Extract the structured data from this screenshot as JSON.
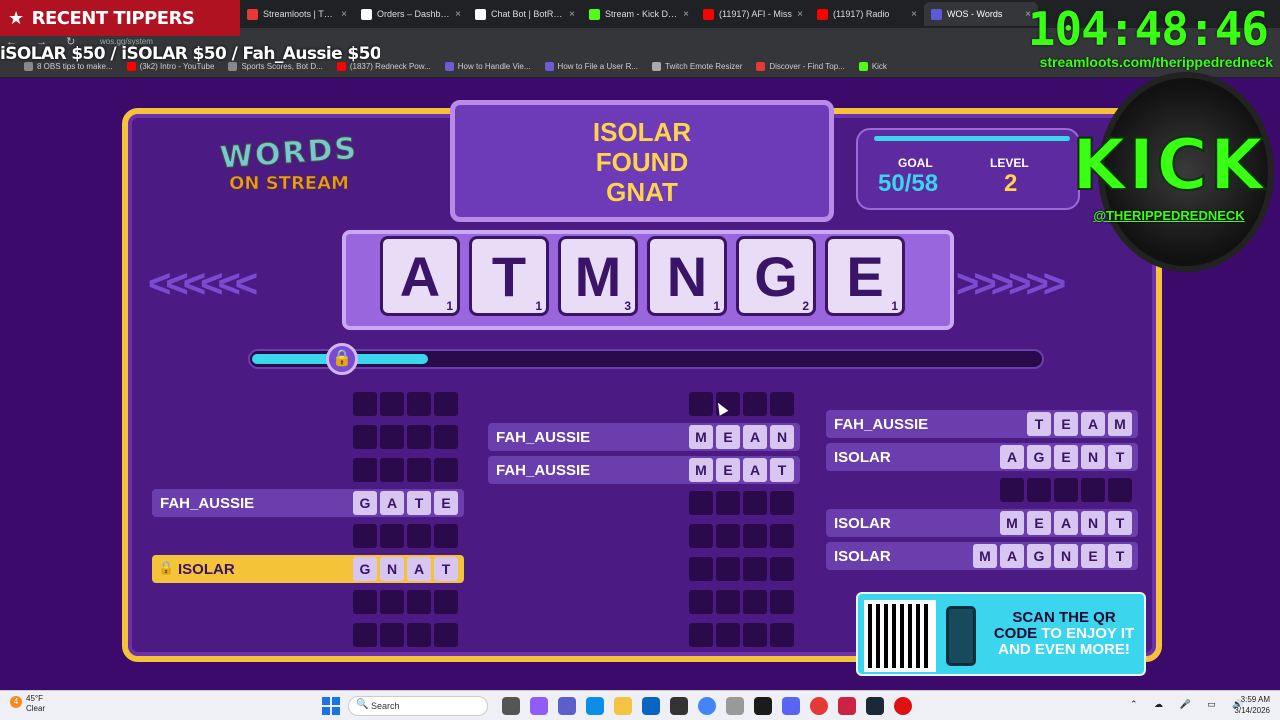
{
  "browser": {
    "tabs": [
      {
        "label": "Streamloots | Ther",
        "color": "#e53935"
      },
      {
        "label": "Orders – Dashboard",
        "color": "#ffffff"
      },
      {
        "label": "Chat Bot | BotRix -",
        "color": "#ffffff"
      },
      {
        "label": "Stream - Kick Dash",
        "color": "#53fc18"
      },
      {
        "label": "(11917) AFI - Miss",
        "color": "#ff0000"
      },
      {
        "label": "(11917) Radio",
        "color": "#ff0000"
      },
      {
        "label": "WOS - Words",
        "color": "#5b5bd6",
        "active": true
      }
    ],
    "url": "wos.gg/system",
    "bookmarks": [
      {
        "label": "8 OBS tips to make...",
        "color": "#888"
      },
      {
        "label": "(3k2) Intro - YouTube",
        "color": "#ff0000"
      },
      {
        "label": "Sports Scores, Bot D...",
        "color": "#888"
      },
      {
        "label": "(1837) Redneck Pow...",
        "color": "#ff0000"
      },
      {
        "label": "How to Handle Vie...",
        "color": "#6b5bd6"
      },
      {
        "label": "How to File a User R...",
        "color": "#6b5bd6"
      },
      {
        "label": "Twitch Emote Resizer",
        "color": "#aaa"
      },
      {
        "label": "Discover - Find Top...",
        "color": "#e53935"
      },
      {
        "label": "Kick",
        "color": "#53fc18"
      }
    ]
  },
  "overlay": {
    "recent_tippers": "RECENT TIPPERS",
    "ticker": "iSOLAR $50 / iSOLAR $50 / Fah_Aussie $50 /",
    "timer": "104:48:46",
    "streamloots_url": "streamloots.com/therippedredneck",
    "kick_word": "KICK",
    "kick_handle": "@THERIPPEDREDNECK"
  },
  "game": {
    "logo_top": "WORDS",
    "logo_bottom": "ON STREAM",
    "message": [
      "ISOLAR",
      "FOUND",
      "GNAT"
    ],
    "goal_label": "GOAL",
    "goal_value": "50/58",
    "level_label": "LEVEL",
    "level_value": "2",
    "letters": [
      {
        "char": "A",
        "pts": "1"
      },
      {
        "char": "T",
        "pts": "1"
      },
      {
        "char": "M",
        "pts": "3"
      },
      {
        "char": "N",
        "pts": "1"
      },
      {
        "char": "G",
        "pts": "2"
      },
      {
        "char": "E",
        "pts": "1"
      }
    ],
    "columns": [
      [
        {
          "name": "",
          "letters": [
            "",
            "",
            "",
            ""
          ]
        },
        {
          "name": "",
          "letters": [
            "",
            "",
            "",
            ""
          ]
        },
        {
          "name": "",
          "letters": [
            "",
            "",
            "",
            ""
          ]
        },
        {
          "name": "FAH_AUSSIE",
          "letters": [
            "G",
            "A",
            "T",
            "E"
          ]
        },
        {
          "name": "",
          "letters": [
            "",
            "",
            "",
            ""
          ]
        },
        {
          "name": "ISOLAR",
          "letters": [
            "G",
            "N",
            "A",
            "T"
          ],
          "highlight": true
        },
        {
          "name": "",
          "letters": [
            "",
            "",
            "",
            ""
          ]
        },
        {
          "name": "",
          "letters": [
            "",
            "",
            "",
            ""
          ]
        }
      ],
      [
        {
          "name": "",
          "letters": [
            "",
            "",
            "",
            ""
          ]
        },
        {
          "name": "FAH_AUSSIE",
          "letters": [
            "M",
            "E",
            "A",
            "N"
          ]
        },
        {
          "name": "FAH_AUSSIE",
          "letters": [
            "M",
            "E",
            "A",
            "T"
          ]
        },
        {
          "name": "",
          "letters": [
            "",
            "",
            "",
            ""
          ]
        },
        {
          "name": "",
          "letters": [
            "",
            "",
            "",
            ""
          ]
        },
        {
          "name": "",
          "letters": [
            "",
            "",
            "",
            ""
          ]
        },
        {
          "name": "",
          "letters": [
            "",
            "",
            "",
            ""
          ]
        },
        {
          "name": "",
          "letters": [
            "",
            "",
            "",
            ""
          ]
        }
      ],
      [
        {
          "name": "FAH_AUSSIE",
          "letters": [
            "T",
            "E",
            "A",
            "M"
          ]
        },
        {
          "name": "ISOLAR",
          "letters": [
            "A",
            "G",
            "E",
            "N",
            "T"
          ]
        },
        {
          "name": "",
          "letters": [
            "",
            "",
            "",
            "",
            ""
          ]
        },
        {
          "name": "ISOLAR",
          "letters": [
            "M",
            "E",
            "A",
            "N",
            "T"
          ]
        },
        {
          "name": "ISOLAR",
          "letters": [
            "M",
            "A",
            "G",
            "N",
            "E",
            "T"
          ]
        }
      ]
    ],
    "qr_line1": "SCAN THE QR",
    "qr_line2a": "CODE",
    "qr_line2b": "TO ENJOY IT",
    "qr_line3": "AND EVEN MORE!"
  },
  "taskbar": {
    "weather_temp": "45°F",
    "weather_desc": "Clear",
    "weather_badge": "4",
    "search_placeholder": "Search",
    "time": "3:59 AM",
    "date": "3/14/2026"
  }
}
